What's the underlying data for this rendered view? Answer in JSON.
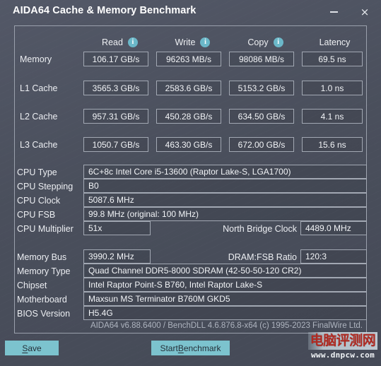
{
  "window": {
    "title": "AIDA64 Cache & Memory Benchmark",
    "minimize_label": "–",
    "close_label": "×"
  },
  "benchmark": {
    "columns": [
      {
        "label": "Read",
        "has_info": true,
        "info_glyph": "i"
      },
      {
        "label": "Write",
        "has_info": true,
        "info_glyph": "i"
      },
      {
        "label": "Copy",
        "has_info": true,
        "info_glyph": "i"
      },
      {
        "label": "Latency",
        "has_info": false,
        "info_glyph": ""
      }
    ],
    "rows": [
      {
        "label": "Memory",
        "read": "106.17 GB/s",
        "write": "96263 MB/s",
        "copy": "98086 MB/s",
        "latency": "69.5 ns"
      },
      {
        "label": "L1 Cache",
        "read": "3565.3 GB/s",
        "write": "2583.6 GB/s",
        "copy": "5153.2 GB/s",
        "latency": "1.0 ns"
      },
      {
        "label": "L2 Cache",
        "read": "957.31 GB/s",
        "write": "450.28 GB/s",
        "copy": "634.50 GB/s",
        "latency": "4.1 ns"
      },
      {
        "label": "L3 Cache",
        "read": "1050.7 GB/s",
        "write": "463.30 GB/s",
        "copy": "672.00 GB/s",
        "latency": "15.6 ns"
      }
    ]
  },
  "cpu_info": {
    "cpu_type_label": "CPU Type",
    "cpu_type_value": "6C+8c Intel Core i5-13600  (Raptor Lake-S, LGA1700)",
    "cpu_stepping_label": "CPU Stepping",
    "cpu_stepping_value": "B0",
    "cpu_clock_label": "CPU Clock",
    "cpu_clock_value": "5087.6 MHz",
    "cpu_fsb_label": "CPU FSB",
    "cpu_fsb_value": "99.8 MHz  (original: 100 MHz)",
    "cpu_multiplier_label": "CPU Multiplier",
    "cpu_multiplier_value": "51x",
    "north_bridge_clock_label": "North Bridge Clock",
    "north_bridge_clock_value": "4489.0 MHz"
  },
  "memory_info": {
    "memory_bus_label": "Memory Bus",
    "memory_bus_value": "3990.2 MHz",
    "dram_fsb_ratio_label": "DRAM:FSB Ratio",
    "dram_fsb_ratio_value": "120:3",
    "memory_type_label": "Memory Type",
    "memory_type_value": "Quad Channel DDR5-8000 SDRAM  (42-50-50-120 CR2)",
    "chipset_label": "Chipset",
    "chipset_value": "Intel Raptor Point-S B760, Intel Raptor Lake-S",
    "motherboard_label": "Motherboard",
    "motherboard_value": "Maxsun MS Terminator B760M GKD5",
    "bios_version_label": "BIOS Version",
    "bios_version_value": "H5.4G"
  },
  "footer": {
    "version_text": "AIDA64 v6.88.6400 / BenchDLL 4.6.876.8-x64  (c) 1995-2023 FinalWire Ltd.",
    "save_button": "Save",
    "save_accel": "S",
    "save_rest": "ave",
    "start_button_pre": "Start ",
    "start_accel": "B",
    "start_rest": "enchmark"
  },
  "watermark": {
    "chinese": "电脑评测网",
    "url": "www.dnpcw.com"
  },
  "colors": {
    "window_bg": "#4a4f5c",
    "accent_button": "#7cc3ce",
    "info_icon": "#6bb8c9",
    "border": "#a2a8b3"
  }
}
